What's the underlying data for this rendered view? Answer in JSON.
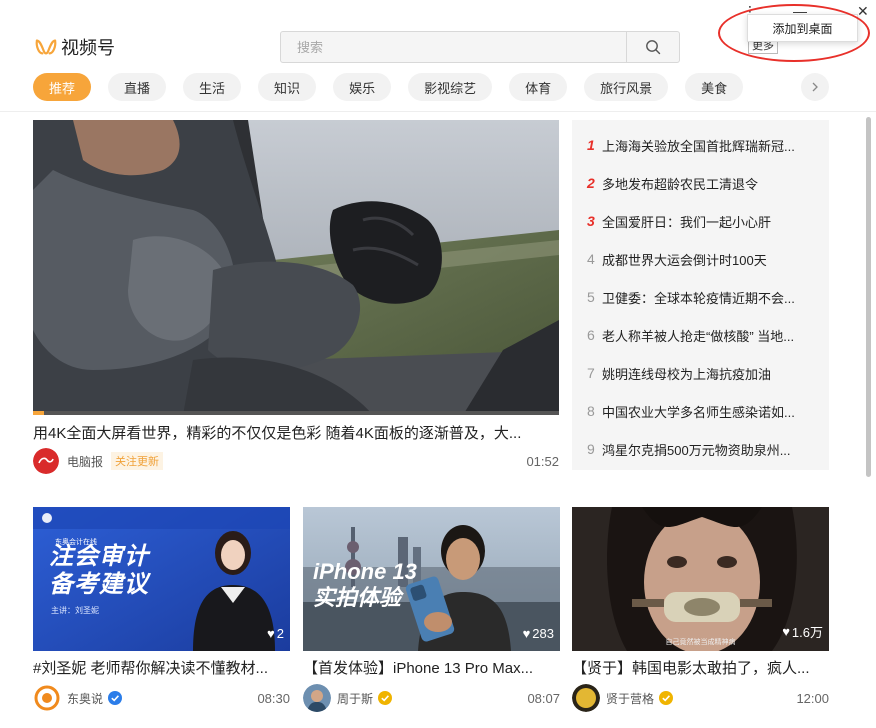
{
  "header": {
    "logo_text": "视频号",
    "search_placeholder": "搜索",
    "more_label": "更多",
    "popup_label": "添加到桌面"
  },
  "tabs": [
    {
      "label": "推荐",
      "active": true
    },
    {
      "label": "直播"
    },
    {
      "label": "生活"
    },
    {
      "label": "知识"
    },
    {
      "label": "娱乐"
    },
    {
      "label": "影视综艺"
    },
    {
      "label": "体育"
    },
    {
      "label": "旅行风景"
    },
    {
      "label": "美食"
    }
  ],
  "featured": {
    "title": "用4K全面大屏看世界，精彩的不仅仅是色彩 随着4K面板的逐渐普及，大...",
    "author": "电脑报",
    "badge": "关注更新",
    "duration": "01:52",
    "progress": 0.02,
    "avatar_text": "电脑报"
  },
  "hotlist": [
    {
      "rank": "1",
      "text": "上海海关验放全国首批辉瑞新冠..."
    },
    {
      "rank": "2",
      "text": "多地发布超龄农民工清退令"
    },
    {
      "rank": "3",
      "text": "全国爱肝日：我们一起小心肝"
    },
    {
      "rank": "4",
      "text": "成都世界大运会倒计时100天"
    },
    {
      "rank": "5",
      "text": "卫健委：全球本轮疫情近期不会..."
    },
    {
      "rank": "6",
      "text": "老人称羊被人抢走“做核酸” 当地..."
    },
    {
      "rank": "7",
      "text": "姚明连线母校为上海抗疫加油"
    },
    {
      "rank": "8",
      "text": "中国农业大学多名师生感染诺如..."
    },
    {
      "rank": "9",
      "text": "鸿星尔克捐500万元物资助泉州..."
    }
  ],
  "cards": [
    {
      "title": "#刘圣妮 老师帮你解决读不懂教材...",
      "author": "东奥说",
      "duration": "08:30",
      "likes": "2",
      "thumb_line1": "注会审计",
      "thumb_line2": "备考建议",
      "thumb_small": "主讲：刘圣妮",
      "thumb_brand": "东奥会计在线"
    },
    {
      "title": "【首发体验】iPhone 13 Pro Max...",
      "author": "周于斯",
      "duration": "08:07",
      "likes": "283",
      "thumb_line1": "iPhone 13",
      "thumb_line2": "实拍体验"
    },
    {
      "title": "【贤于】韩国电影太敢拍了，疯人...",
      "author": "贤于营格",
      "duration": "12:00",
      "likes": "1.6万",
      "thumb_caption": "自己竟然被当成精神病",
      "avatar_text": "贤"
    }
  ],
  "colors": {
    "accent": "#f7a53a",
    "hot_rank": "#e8302a",
    "verified": "#f0b400"
  }
}
